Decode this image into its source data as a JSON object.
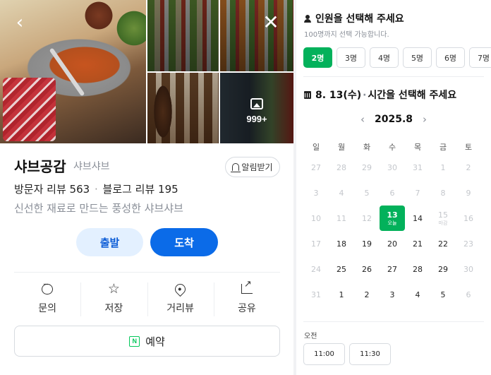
{
  "place": {
    "name": "샤브공감",
    "category": "샤브샤브",
    "notify_label": "알림받기",
    "visitor_reviews": "방문자 리뷰 563",
    "blog_reviews": "블로그 리뷰 195",
    "review_sep": "·",
    "description": "신선한 재료로 만드는 풍성한 샤브샤브",
    "gallery_count": "999+"
  },
  "nav": {
    "back_icon": "‹",
    "close_icon": "✕"
  },
  "route": {
    "depart_label": "출발",
    "arrive_label": "도착"
  },
  "actions": [
    {
      "label": "문의",
      "icon": "chat-icon"
    },
    {
      "label": "저장",
      "icon": "star-icon"
    },
    {
      "label": "거리뷰",
      "icon": "location-pin-icon"
    },
    {
      "label": "공유",
      "icon": "share-icon"
    }
  ],
  "reserve": {
    "label": "예약",
    "icon_text": "N"
  },
  "booking": {
    "people_title": "인원을 선택해 주세요",
    "people_sub": "100명까지 선택 가능합니다.",
    "people_options": [
      "2명",
      "3명",
      "4명",
      "5명",
      "6명",
      "7명"
    ],
    "people_selected": "2명",
    "date_title_date": "8. 13(수)",
    "date_title_sep": "·",
    "date_title_text": "시간을 선택해 주세요",
    "month": "2025.8",
    "prev_icon": "‹",
    "next_icon": "›",
    "weekdays": [
      "일",
      "월",
      "화",
      "수",
      "목",
      "금",
      "토"
    ],
    "weeks": [
      [
        {
          "d": "27",
          "m": true
        },
        {
          "d": "28",
          "m": true
        },
        {
          "d": "29",
          "m": true
        },
        {
          "d": "30",
          "m": true
        },
        {
          "d": "31",
          "m": true
        },
        {
          "d": "1",
          "m": true
        },
        {
          "d": "2",
          "m": true
        }
      ],
      [
        {
          "d": "3",
          "m": true
        },
        {
          "d": "4",
          "m": true
        },
        {
          "d": "5",
          "m": true
        },
        {
          "d": "6",
          "m": true
        },
        {
          "d": "7",
          "m": true
        },
        {
          "d": "8",
          "m": true
        },
        {
          "d": "9",
          "m": true
        }
      ],
      [
        {
          "d": "10",
          "m": true
        },
        {
          "d": "11",
          "m": true
        },
        {
          "d": "12",
          "m": true
        },
        {
          "d": "13",
          "today": true,
          "tag": "오늘"
        },
        {
          "d": "14"
        },
        {
          "d": "15",
          "m": true,
          "tag": "마감"
        },
        {
          "d": "16",
          "m": true
        }
      ],
      [
        {
          "d": "17",
          "m": true
        },
        {
          "d": "18"
        },
        {
          "d": "19"
        },
        {
          "d": "20"
        },
        {
          "d": "21"
        },
        {
          "d": "22"
        },
        {
          "d": "23",
          "m": true
        }
      ],
      [
        {
          "d": "24",
          "m": true
        },
        {
          "d": "25"
        },
        {
          "d": "26"
        },
        {
          "d": "27"
        },
        {
          "d": "28"
        },
        {
          "d": "29"
        },
        {
          "d": "30",
          "m": true
        }
      ],
      [
        {
          "d": "31",
          "m": true
        },
        {
          "d": "1"
        },
        {
          "d": "2"
        },
        {
          "d": "3"
        },
        {
          "d": "4"
        },
        {
          "d": "5"
        },
        {
          "d": "6",
          "m": true
        }
      ]
    ],
    "ampm_label": "오전",
    "times": [
      "11:00",
      "11:30"
    ]
  },
  "colors": {
    "brand_green": "#03b15b",
    "naver_green": "#03c75a",
    "arrive_blue": "#0b6be8",
    "depart_bg": "#e3f0ff"
  }
}
